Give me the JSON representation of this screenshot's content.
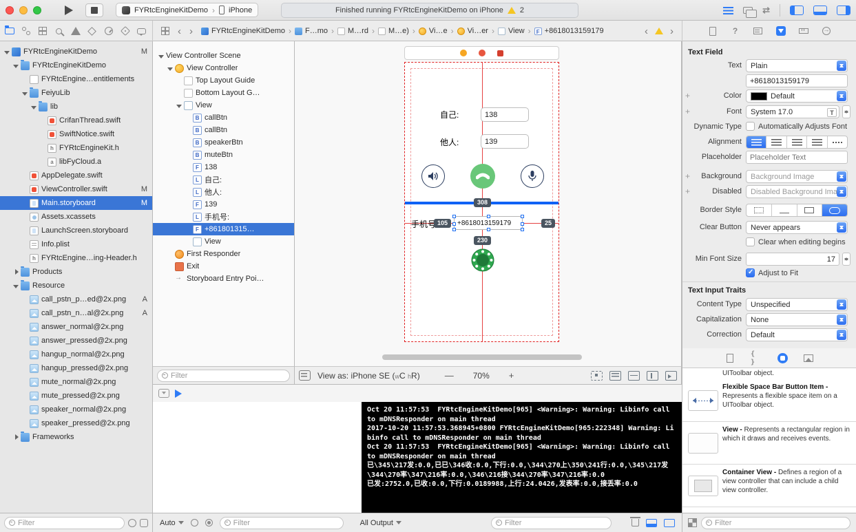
{
  "titlebar": {
    "scheme_app": "FYRtcEngineKitDemo",
    "scheme_device": "iPhone",
    "status_text": "Finished running FYRtcEngineKitDemo on iPhone",
    "warning_count": "2"
  },
  "jumpbar": {
    "crumbs": [
      {
        "label": "FYRtcEngineKitDemo",
        "icon": "ji-app"
      },
      {
        "label": "F…mo",
        "icon": "ji-folder"
      },
      {
        "label": "M…rd",
        "icon": "ji-file"
      },
      {
        "label": "M…e)",
        "icon": "ji-file"
      },
      {
        "label": "Vi…e",
        "icon": "ji-vc"
      },
      {
        "label": "Vi…er",
        "icon": "ji-vc"
      },
      {
        "label": "View",
        "icon": "ji-view"
      },
      {
        "label": "+8618013159179",
        "icon": "ji-field",
        "glyph": "F"
      }
    ]
  },
  "navigator": {
    "filter_placeholder": "Filter",
    "items": [
      {
        "label": "FYRtcEngineKitDemo",
        "depth": 0,
        "icon": "fi-app",
        "disclosure": "open",
        "badge": "M"
      },
      {
        "label": "FYRtcEngineKitDemo",
        "depth": 1,
        "icon": "fi-folder",
        "disclosure": "open"
      },
      {
        "label": "FYRtcEngine…entitlements",
        "depth": 2,
        "icon": "fi-doc"
      },
      {
        "label": "FeiyuLib",
        "depth": 2,
        "icon": "fi-folder",
        "disclosure": "open"
      },
      {
        "label": "lib",
        "depth": 3,
        "icon": "fi-folder",
        "disclosure": "open"
      },
      {
        "label": "CrifanThread.swift",
        "depth": 4,
        "icon": "fi-swift"
      },
      {
        "label": "SwiftNotice.swift",
        "depth": 4,
        "icon": "fi-swift"
      },
      {
        "label": "FYRtcEngineKit.h",
        "depth": 4,
        "icon": "fi-h",
        "glyph": "h"
      },
      {
        "label": "libFyCloud.a",
        "depth": 4,
        "icon": "fi-a",
        "glyph": "a"
      },
      {
        "label": "AppDelegate.swift",
        "depth": 2,
        "icon": "fi-swift"
      },
      {
        "label": "ViewController.swift",
        "depth": 2,
        "icon": "fi-swift",
        "badge": "M"
      },
      {
        "label": "Main.storyboard",
        "depth": 2,
        "icon": "fi-sb",
        "badge": "M",
        "selected": true
      },
      {
        "label": "Assets.xcassets",
        "depth": 2,
        "icon": "fi-assets"
      },
      {
        "label": "LaunchScreen.storyboard",
        "depth": 2,
        "icon": "fi-sb"
      },
      {
        "label": "Info.plist",
        "depth": 2,
        "icon": "fi-plist"
      },
      {
        "label": "FYRtcEngine…ing-Header.h",
        "depth": 2,
        "icon": "fi-h",
        "glyph": "h"
      },
      {
        "label": "Products",
        "depth": 1,
        "icon": "fi-folder",
        "disclosure": "closed"
      },
      {
        "label": "Resource",
        "depth": 1,
        "icon": "fi-folder",
        "disclosure": "open"
      },
      {
        "label": "call_pstn_p…ed@2x.png",
        "depth": 2,
        "icon": "fi-png",
        "badge": "A"
      },
      {
        "label": "call_pstn_n…al@2x.png",
        "depth": 2,
        "icon": "fi-png",
        "badge": "A"
      },
      {
        "label": "answer_normal@2x.png",
        "depth": 2,
        "icon": "fi-png"
      },
      {
        "label": "answer_pressed@2x.png",
        "depth": 2,
        "icon": "fi-png"
      },
      {
        "label": "hangup_normal@2x.png",
        "depth": 2,
        "icon": "fi-png"
      },
      {
        "label": "hangup_pressed@2x.png",
        "depth": 2,
        "icon": "fi-png"
      },
      {
        "label": "mute_normal@2x.png",
        "depth": 2,
        "icon": "fi-png"
      },
      {
        "label": "mute_pressed@2x.png",
        "depth": 2,
        "icon": "fi-png"
      },
      {
        "label": "speaker_normal@2x.png",
        "depth": 2,
        "icon": "fi-png"
      },
      {
        "label": "speaker_pressed@2x.png",
        "depth": 2,
        "icon": "fi-png"
      },
      {
        "label": "Frameworks",
        "depth": 1,
        "icon": "fi-folder",
        "disclosure": "closed"
      }
    ]
  },
  "outline": {
    "filter_placeholder": "Filter",
    "items": [
      {
        "label": "View Controller Scene",
        "depth": 0,
        "icon": "",
        "disclosure": "open"
      },
      {
        "label": "View Controller",
        "depth": 1,
        "icon": "oi-vc",
        "disclosure": "open"
      },
      {
        "label": "Top Layout Guide",
        "depth": 2,
        "icon": "oi-guide"
      },
      {
        "label": "Bottom Layout G…",
        "depth": 2,
        "icon": "oi-guide"
      },
      {
        "label": "View",
        "depth": 2,
        "icon": "oi-view",
        "disclosure": "open"
      },
      {
        "label": "callBtn",
        "depth": 3,
        "icon": "oi-glyph",
        "glyph": "B"
      },
      {
        "label": "callBtn",
        "depth": 3,
        "icon": "oi-glyph",
        "glyph": "B"
      },
      {
        "label": "speakerBtn",
        "depth": 3,
        "icon": "oi-glyph",
        "glyph": "B"
      },
      {
        "label": "muteBtn",
        "depth": 3,
        "icon": "oi-glyph",
        "glyph": "B"
      },
      {
        "label": "138",
        "depth": 3,
        "icon": "oi-glyph",
        "glyph": "F"
      },
      {
        "label": "自己:",
        "depth": 3,
        "icon": "oi-glyph",
        "glyph": "L"
      },
      {
        "label": "他人:",
        "depth": 3,
        "icon": "oi-glyph",
        "glyph": "L"
      },
      {
        "label": "139",
        "depth": 3,
        "icon": "oi-glyph",
        "glyph": "F"
      },
      {
        "label": "手机号:",
        "depth": 3,
        "icon": "oi-glyph",
        "glyph": "L"
      },
      {
        "label": "+861801315…",
        "depth": 3,
        "icon": "oi-glyph",
        "glyph": "F",
        "selected": true
      },
      {
        "label": "View",
        "depth": 3,
        "icon": "oi-view"
      },
      {
        "label": "First Responder",
        "depth": 1,
        "icon": "oi-responder"
      },
      {
        "label": "Exit",
        "depth": 1,
        "icon": "oi-exit"
      },
      {
        "label": "Storyboard Entry Poi…",
        "depth": 1,
        "icon": "oi-entry"
      }
    ]
  },
  "canvas": {
    "scene": {
      "label_self": "自己:",
      "field_self": "138",
      "label_other": "他人:",
      "field_other": "139",
      "label_phone": "手机号:",
      "field_phone": "+8618013159179",
      "badge_width": "308",
      "badge_leading": "105",
      "badge_trailing": "25",
      "badge_below": "230"
    },
    "bar": {
      "view_as_prefix": "View as: iPhone SE (",
      "w_small": "w",
      "w_big": "C",
      "h_small": "h",
      "h_big": "R",
      "suffix": ")",
      "zoom_out": "—",
      "zoom": "70%",
      "zoom_in": "+"
    }
  },
  "debug": {
    "auto_label": "Auto",
    "all_output_label": "All Output",
    "filter_placeholder": "Filter",
    "console_lines": [
      "Oct 20 11:57:53  FYRtcEngineKitDemo[965] <Warning>: Warning: Libinfo call to mDNSResponder on main thread",
      "2017-10-20 11:57:53.368945+0800 FYRtcEngineKitDemo[965:222348] Warning: Libinfo call to mDNSResponder on main thread",
      "Oct 20 11:57:53  FYRtcEngineKitDemo[965] <Warning>: Warning: Libinfo call to mDNSResponder on main thread",
      "已\\345\\217发:0.0,已已\\346收:0.0,下行:0.0,\\344\\270上\\350\\241行:0.0,\\345\\217发\\344\\270率\\347\\216率:0.0,\\346\\216接\\344\\270率\\347\\216率:0.0",
      "已发:2752.0,已收:0.0,下行:0.0189988,上行:24.0426,发表率:0.0,接丢率:0.0"
    ]
  },
  "inspector": {
    "title": "Text Field",
    "text_label": "Text",
    "text_mode": "Plain",
    "text_value": "+8618013159179",
    "color_label": "Color",
    "color_value": "Default",
    "font_label": "Font",
    "font_value": "System 17.0",
    "dynamic_label": "Dynamic Type",
    "dynamic_option": "Automatically Adjusts Font",
    "alignment_label": "Alignment",
    "placeholder_label": "Placeholder",
    "placeholder_value": "Placeholder Text",
    "background_label": "Background",
    "background_value": "Background Image",
    "disabled_label": "Disabled",
    "disabled_value": "Disabled Background Ima",
    "border_label": "Border Style",
    "clear_label": "Clear Button",
    "clear_value": "Never appears",
    "clear_editing_option": "Clear when editing begins",
    "minfont_label": "Min Font Size",
    "minfont_value": "17",
    "adjust_option": "Adjust to Fit",
    "traits_title": "Text Input Traits",
    "content_label": "Content Type",
    "content_value": "Unspecified",
    "cap_label": "Capitalization",
    "cap_value": "None",
    "correction_label": "Correction",
    "correction_value": "Default"
  },
  "library": {
    "partial_tail": "UIToolbar object.",
    "items": [
      {
        "name": "Flexible Space Bar Button Item -",
        "desc": "Represents a flexible space item on a UIToolbar object.",
        "icon": "li-flex"
      },
      {
        "name": "View -",
        "desc": "Represents a rectangular region in which it draws and receives events.",
        "icon": "li-view"
      },
      {
        "name": "Container View -",
        "desc": "Defines a region of a view controller that can include a child view controller.",
        "icon": "li-container"
      }
    ],
    "filter_placeholder": "Filter"
  }
}
